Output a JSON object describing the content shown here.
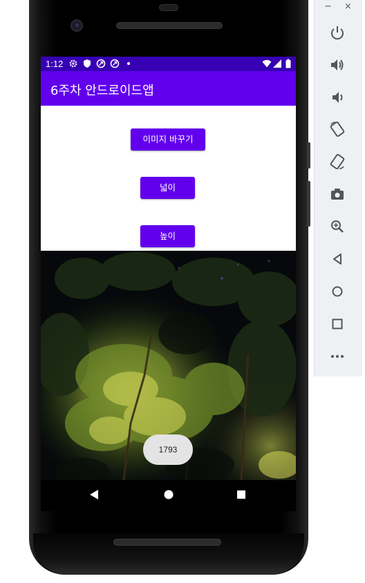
{
  "status_bar": {
    "time": "1:12"
  },
  "app_bar": {
    "title": "6주차 안드로이드앱"
  },
  "buttons": {
    "change_image": "이미지 바꾸기",
    "width": "넓이",
    "height": "높이"
  },
  "toast": {
    "text": "1793"
  },
  "nav_bar": {
    "icons": [
      "back-icon",
      "home-icon",
      "recents-icon"
    ]
  },
  "emulator_panel": {
    "window_controls": {
      "minimize": "−",
      "close": "×"
    },
    "icons": [
      "power-icon",
      "volume-up-icon",
      "volume-down-icon",
      "rotate-left-icon",
      "rotate-right-icon",
      "screenshot-icon",
      "zoom-icon",
      "back-icon",
      "home-icon",
      "overview-icon",
      "more-icon"
    ]
  },
  "colors": {
    "status_bar": "#3700b3",
    "app_bar": "#6200ee",
    "button": "#6200ee",
    "panel": "#eef1f4"
  }
}
